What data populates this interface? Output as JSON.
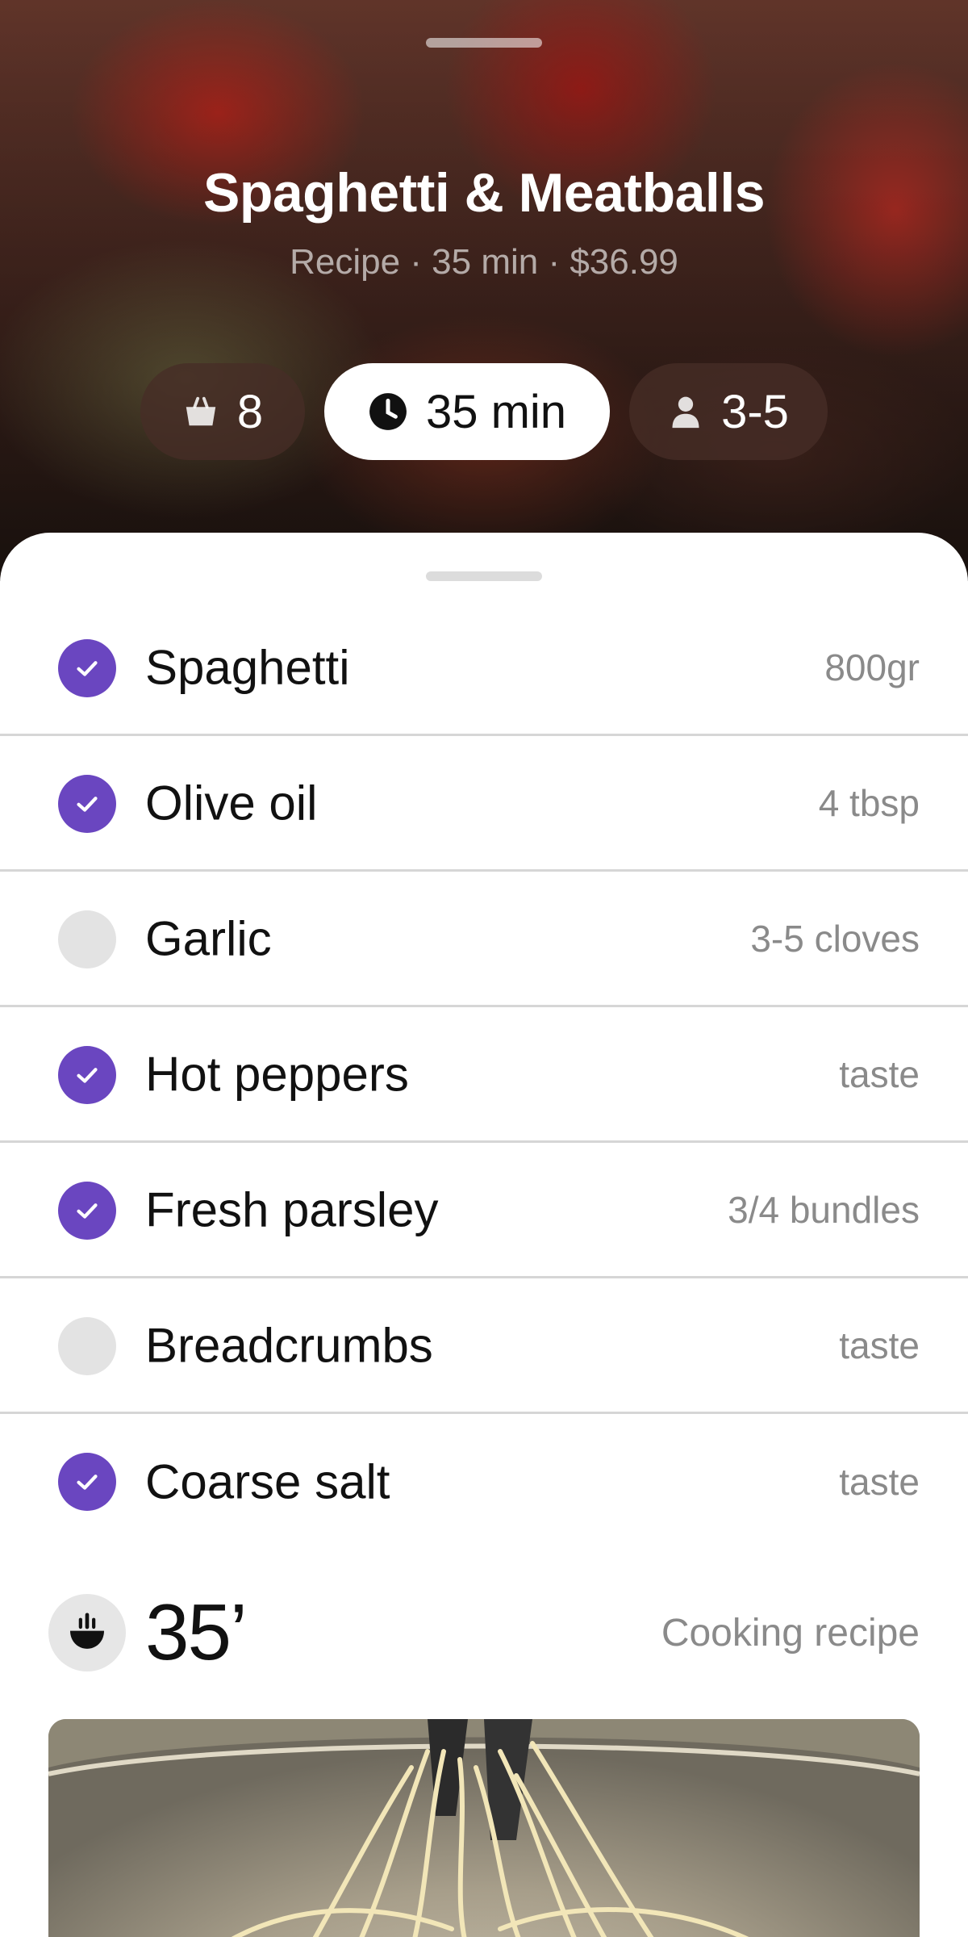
{
  "recipe": {
    "title": "Spaghetti & Meatballs",
    "meta": "Recipe · 35 min · $36.99"
  },
  "chips": [
    {
      "icon": "basket-icon",
      "label": "8",
      "selected": false
    },
    {
      "icon": "clock-icon",
      "label": "35 min",
      "selected": true
    },
    {
      "icon": "person-icon",
      "label": "3-5",
      "selected": false
    }
  ],
  "ingredients": [
    {
      "name": "Spaghetti",
      "qty": "800gr",
      "checked": true
    },
    {
      "name": "Olive oil",
      "qty": "4 tbsp",
      "checked": true
    },
    {
      "name": "Garlic",
      "qty": "3-5 cloves",
      "checked": false
    },
    {
      "name": "Hot peppers",
      "qty": "taste",
      "checked": true
    },
    {
      "name": "Fresh parsley",
      "qty": "3/4 bundles",
      "checked": true
    },
    {
      "name": "Breadcrumbs",
      "qty": "taste",
      "checked": false
    },
    {
      "name": "Coarse salt",
      "qty": "taste",
      "checked": true
    }
  ],
  "cooking": {
    "icon": "pot-icon",
    "time": "35’",
    "label": "Cooking recipe"
  },
  "colors": {
    "accent": "#6a46c0",
    "unchecked": "#e3e3e3",
    "secondary_text": "#8a8a8a"
  }
}
